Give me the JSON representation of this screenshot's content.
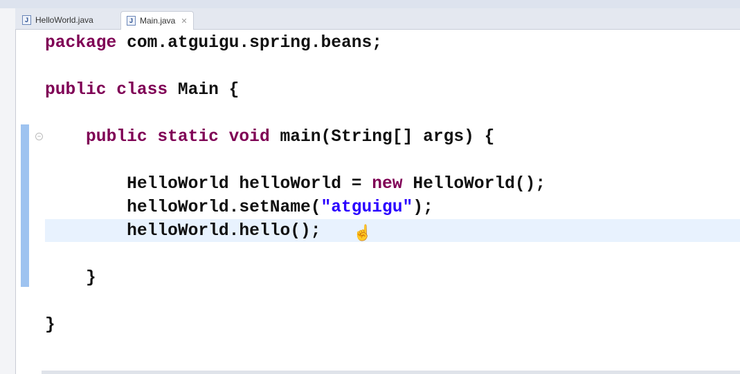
{
  "tabs": [
    {
      "label": "HelloWorld.java",
      "icon": "java-file-icon",
      "active": false
    },
    {
      "label": "Main.java",
      "icon": "java-file-icon",
      "active": true,
      "close": "✕"
    }
  ],
  "colors": {
    "keyword": "#7f0055",
    "string": "#2a00ff",
    "current_line": "#e8f2fe"
  },
  "code": [
    [
      {
        "t": "package",
        "c": "kw"
      },
      {
        "t": " com.atguigu.spring.beans;"
      }
    ],
    [],
    [
      {
        "t": "public class",
        "c": "kw"
      },
      {
        "t": " Main {"
      }
    ],
    [],
    [
      {
        "t": "    "
      },
      {
        "t": "public static void",
        "c": "kw"
      },
      {
        "t": " main(String[] args) {"
      }
    ],
    [],
    [
      {
        "t": "        HelloWorld helloWorld = "
      },
      {
        "t": "new",
        "c": "kw"
      },
      {
        "t": " HelloWorld();"
      }
    ],
    [
      {
        "t": "        helloWorld.setName("
      },
      {
        "t": "\"atguigu\"",
        "c": "str"
      },
      {
        "t": ");"
      }
    ],
    [
      {
        "t": "        helloWorld.hello();"
      }
    ],
    [],
    [
      {
        "t": "    }"
      }
    ],
    [],
    [
      {
        "t": "}"
      }
    ]
  ]
}
